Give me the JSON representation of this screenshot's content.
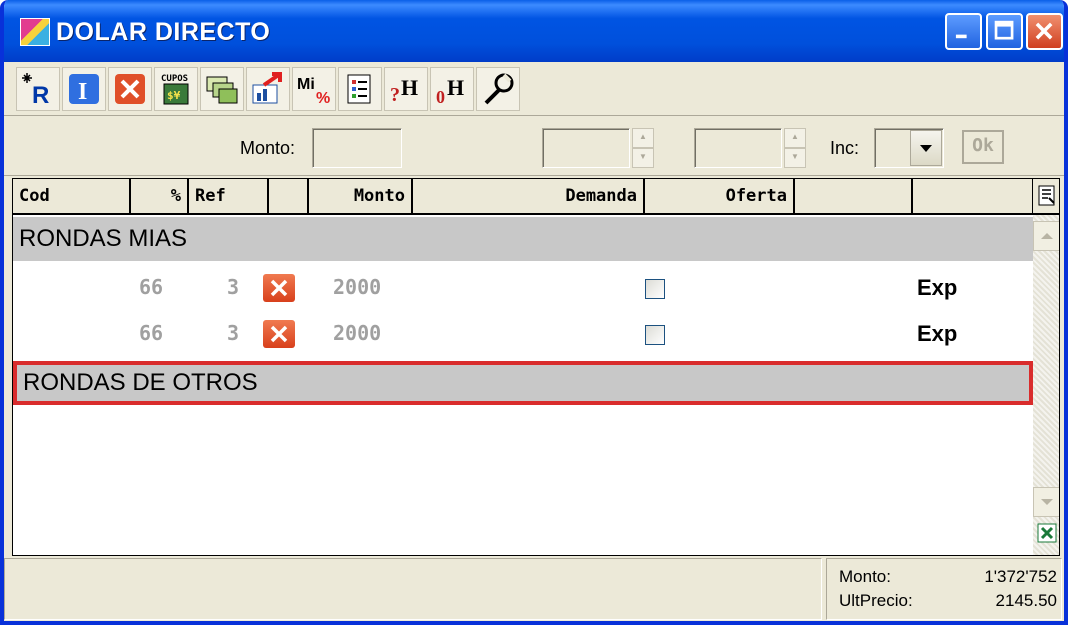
{
  "window": {
    "title": "DOLAR DIRECTO"
  },
  "toolbar": {
    "items": [
      {
        "icon": "new-round-icon",
        "label": "R"
      },
      {
        "icon": "info-icon",
        "label": "I"
      },
      {
        "icon": "cancel-icon",
        "label": ""
      },
      {
        "icon": "cupos-icon",
        "label": "CUPOS"
      },
      {
        "icon": "cards-icon",
        "label": ""
      },
      {
        "icon": "chart-export-icon",
        "label": ""
      },
      {
        "icon": "my-percent-icon",
        "label": "Mi%"
      },
      {
        "icon": "list-icon",
        "label": ""
      },
      {
        "icon": "query-history-icon",
        "label": "?H"
      },
      {
        "icon": "zero-history-icon",
        "label": "0H"
      },
      {
        "icon": "settings-wrench-icon",
        "label": ""
      }
    ]
  },
  "inputs": {
    "monto_label": "Monto:",
    "inc_label": "Inc:",
    "ok_label": "Ok"
  },
  "grid": {
    "headers": [
      "Cod",
      "%",
      "Ref",
      "Monto",
      "Demanda",
      "Oferta"
    ],
    "sections": [
      {
        "title": "RONDAS MIAS",
        "rows": [
          {
            "pct": "66",
            "ref": "3",
            "monto": "2000",
            "status": "Exp"
          },
          {
            "pct": "66",
            "ref": "3",
            "monto": "2000",
            "status": "Exp"
          }
        ]
      },
      {
        "title": "RONDAS DE OTROS",
        "rows": []
      }
    ]
  },
  "status": {
    "monto_label": "Monto:",
    "monto_value": "1'372'752",
    "precio_label": "UltPrecio:",
    "precio_value": "2145.50"
  },
  "colors": {
    "title_bar": "#0054e3",
    "selection_border": "#d92c2c",
    "section_bg": "#c8c8c8",
    "cancel_button": "#d8401c"
  }
}
